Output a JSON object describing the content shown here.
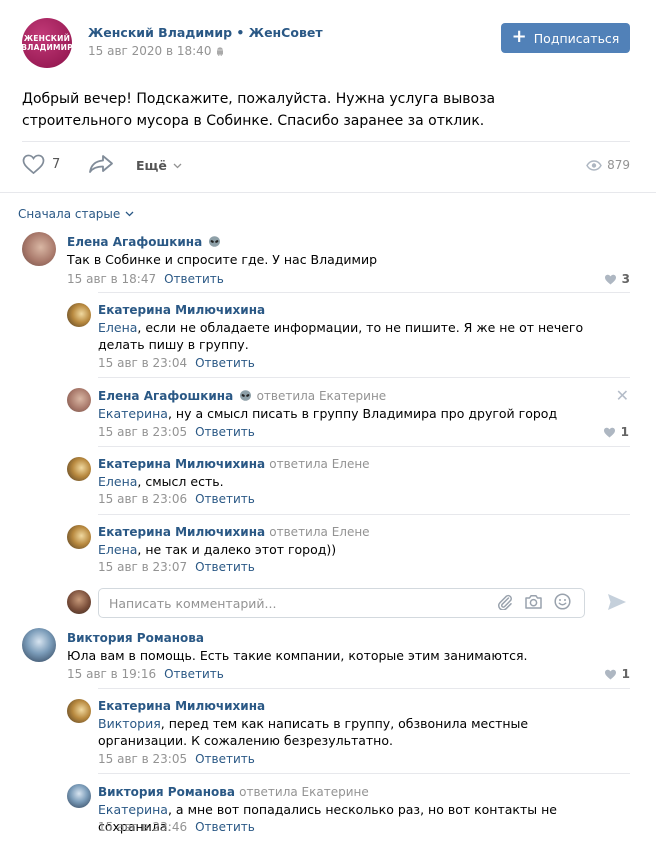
{
  "post": {
    "group_avatar_lines": [
      "ЖЕНСКИЙ",
      "ВЛАДИМИР"
    ],
    "group_name": "Женский Владимир • ЖенСовет",
    "date": "15 авг 2020 в 18:40",
    "subscribe_label": "Подписаться",
    "text": "Добрый вечер! Подскажите, пожалуйста. Нужна услуга вывоза строительного мусора в Собинке. Спасибо заранее за отклик.",
    "like_count": "7",
    "more_label": "Ещё",
    "views": "879",
    "accent_color": "#5181b8",
    "link_color": "#2a5885",
    "brand_color": "#9c1d57"
  },
  "comments": {
    "sort_label": "Сначала старые",
    "reply_label": "Ответить",
    "items": [
      {
        "author": "Елена Агафошкина",
        "badge_icon": "alien-icon",
        "replied": "",
        "addr": "",
        "text": "Так в Собинке и спросите где. У нас Владимир",
        "time": "15 авг в 18:47",
        "likes": "3"
      },
      {
        "author": "Екатерина Милючихина",
        "replied": "",
        "addr": "Елена",
        "text": ", если не обладаете информации, то не пишите. Я же не от нечего делать пишу в группу.",
        "time": "15 авг в 23:04",
        "likes": ""
      },
      {
        "author": "Елена Агафошкина",
        "badge_icon": "alien-icon",
        "replied": "ответила Екатерине",
        "addr": "Екатерина",
        "text": ", ну а смысл писать в группу Владимира про другой город",
        "time": "15 авг в 23:05",
        "likes": "1"
      },
      {
        "author": "Екатерина Милючихина",
        "replied": "ответила Елене",
        "addr": "Елена",
        "text": ", смысл есть.",
        "time": "15 авг в 23:06",
        "likes": ""
      },
      {
        "author": "Екатерина Милючихина",
        "replied": "ответила Елене",
        "addr": "Елена",
        "text": ", не так и далеко этот город))",
        "time": "15 авг в 23:07",
        "likes": ""
      },
      {
        "author": "Виктория Романова",
        "replied": "",
        "addr": "",
        "text": "Юла вам в помощь. Есть такие компании, которые этим занимаются.",
        "time": "15 авг в 19:16",
        "likes": "1"
      },
      {
        "author": "Екатерина Милючихина",
        "replied": "",
        "addr": "Виктория",
        "text": ", перед тем как написать в группу, обзвонила местные организации. К сожалению безрезультатно.",
        "time": "15 авг в 23:05",
        "likes": ""
      },
      {
        "author": "Виктория Романова",
        "replied": "ответила Екатерине",
        "addr": "Екатерина",
        "text": ", а мне вот попадались несколько раз, но вот контакты не сохранила.",
        "time": "15 авг в 23:46",
        "likes": ""
      }
    ]
  },
  "composer": {
    "placeholder": "Написать комментарий..."
  }
}
